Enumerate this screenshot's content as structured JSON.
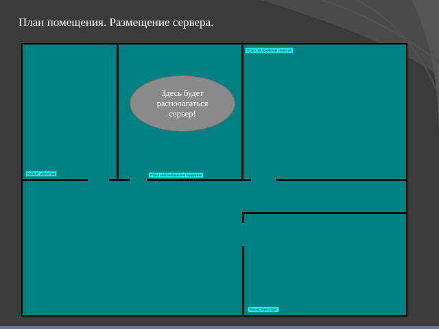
{
  "slide": {
    "title": "План помещения. Размещение сервера."
  },
  "plan": {
    "background_color": "#008080",
    "server_callout": "Здесь будет располагаться сервер!",
    "rooms": {
      "director": "Кабинет Директора",
      "info_support": "Отдел информационной поддержки",
      "client_service": "Отдел обслуживания клиентов",
      "finance": "Финансовый отдел"
    }
  }
}
